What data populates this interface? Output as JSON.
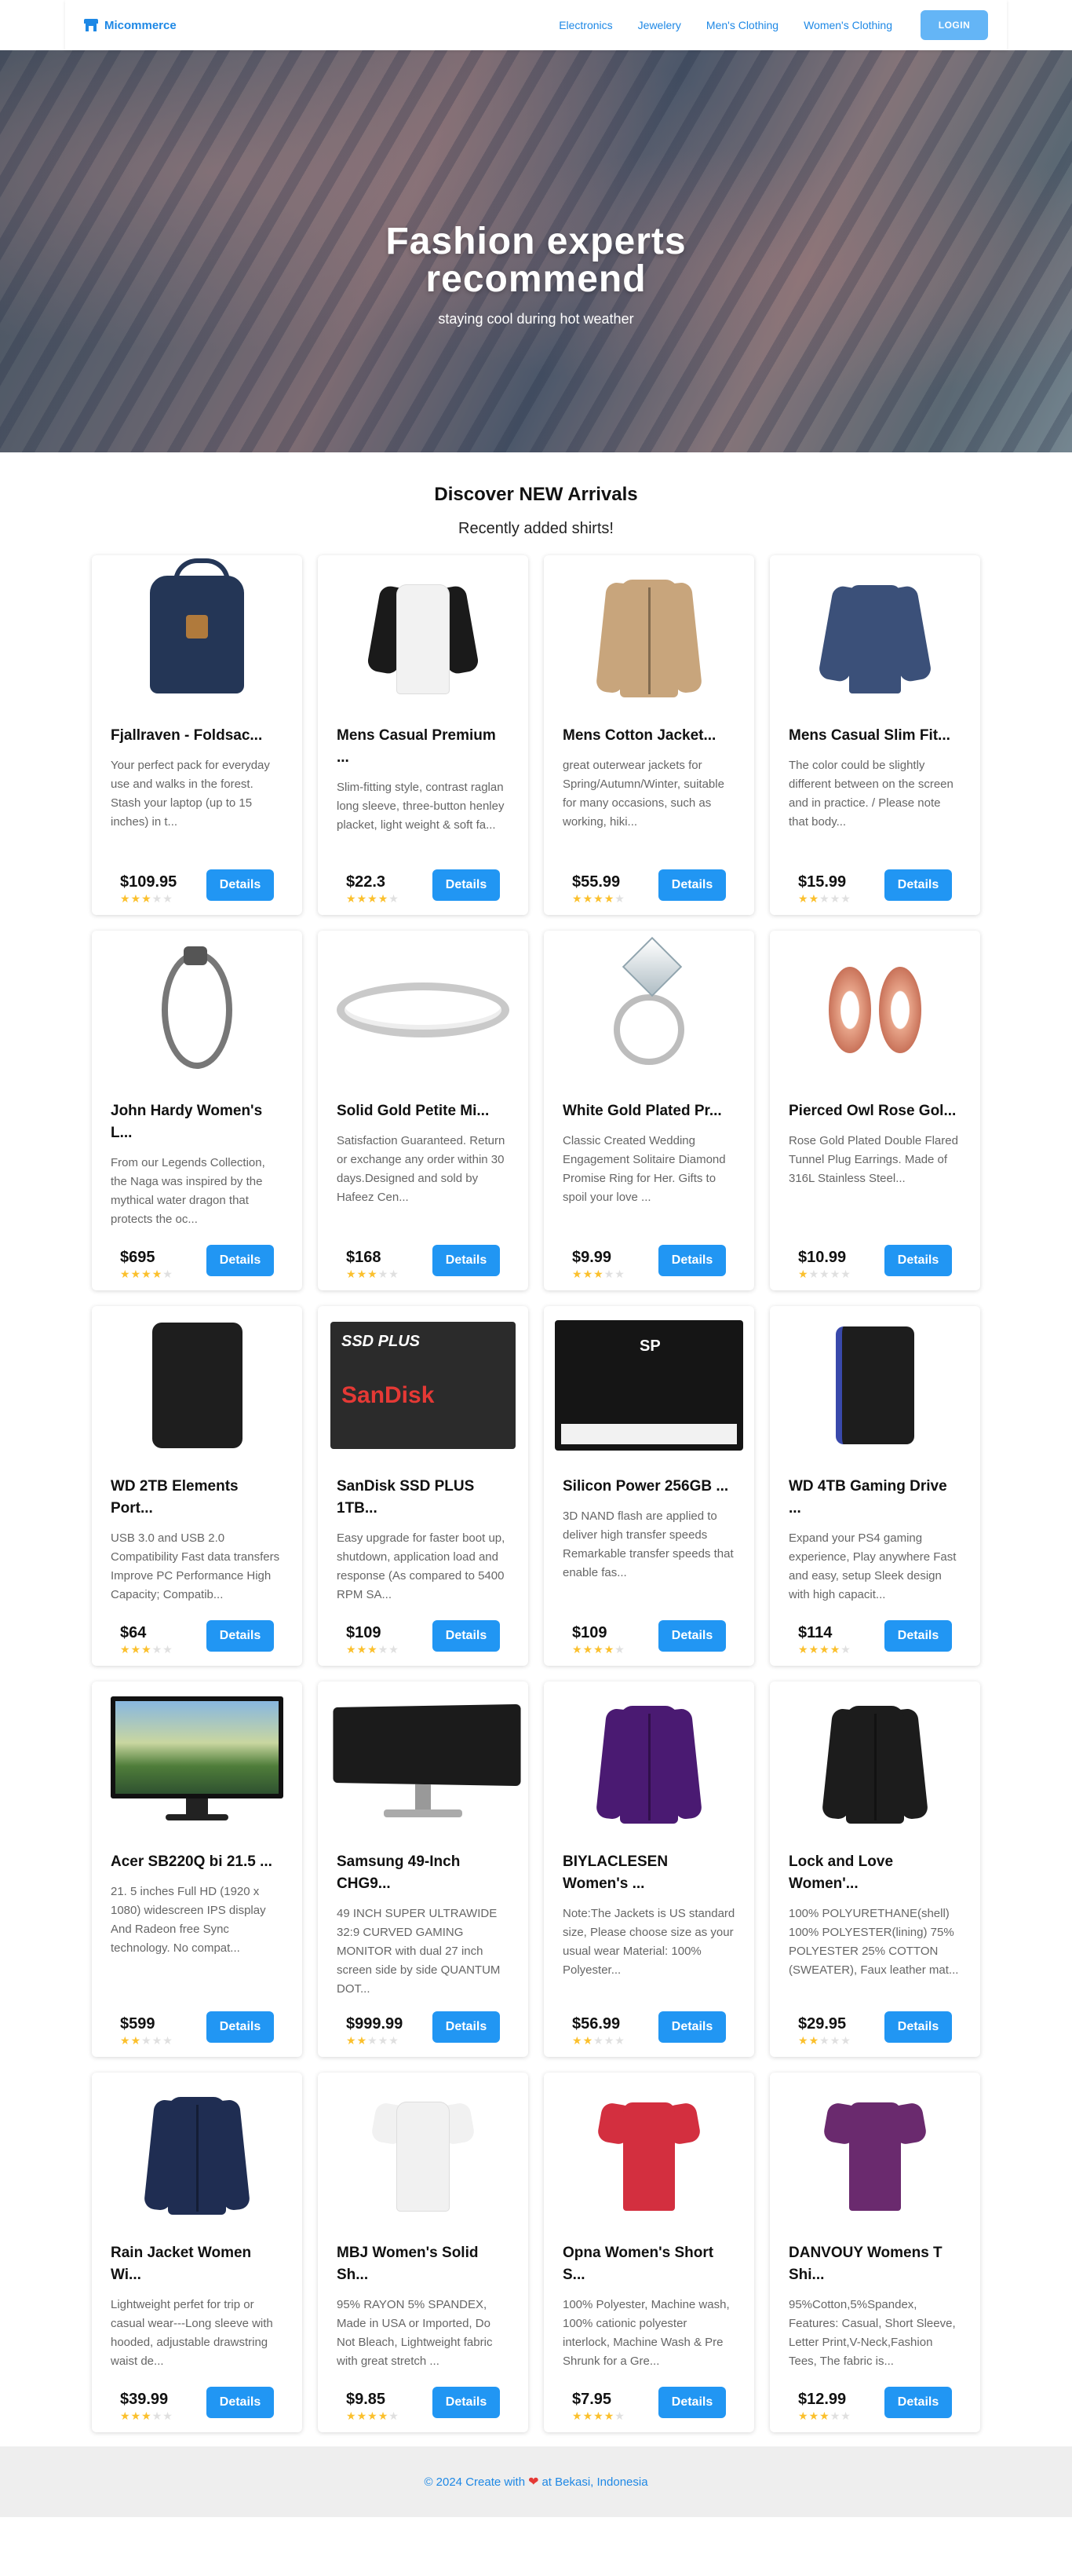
{
  "brand": {
    "name": "Micommerce"
  },
  "nav": {
    "links": [
      "Electronics",
      "Jewelery",
      "Men's Clothing",
      "Women's Clothing"
    ],
    "login_label": "LOGIN"
  },
  "hero": {
    "title_line1": "Fashion experts",
    "title_line2": "recommend",
    "subtitle": "staying cool during hot weather"
  },
  "section": {
    "title": "Discover NEW Arrivals",
    "subtitle": "Recently added shirts!"
  },
  "details_label": "Details",
  "products": [
    {
      "title": "Fjallraven - Foldsac...",
      "description": "Your perfect pack for everyday use and walks in the forest. Stash your laptop (up to 15 inches) in t...",
      "price": "$109.95",
      "rating": 3,
      "image": "backpack",
      "colors": {
        "a": "#243656"
      }
    },
    {
      "title": "Mens Casual Premium ...",
      "description": "Slim-fitting style, contrast raglan long sleeve, three-button henley placket, light weight & soft fa...",
      "price": "$22.3",
      "rating": 4,
      "image": "raglan-tee",
      "colors": {
        "a": "#f2f2f2",
        "b": "#1a1a1a"
      }
    },
    {
      "title": "Mens Cotton Jacket...",
      "description": "great outerwear jackets for Spring/Autumn/Winter, suitable for many occasions, such as working, hiki...",
      "price": "$55.99",
      "rating": 4,
      "image": "cotton-jacket",
      "colors": {
        "a": "#c8a57c"
      }
    },
    {
      "title": "Mens Casual Slim Fit...",
      "description": "The color could be slightly different between on the screen and in practice. / Please note that body...",
      "price": "$15.99",
      "rating": 2,
      "image": "slim-fit-shirt",
      "colors": {
        "a": "#3b5079"
      }
    },
    {
      "title": "John Hardy Women's L...",
      "description": "From our Legends Collection, the Naga was inspired by the mythical water dragon that protects the oc...",
      "price": "$695",
      "rating": 4,
      "image": "bracelet",
      "colors": {
        "a": "#777777"
      }
    },
    {
      "title": "Solid Gold Petite Mi...",
      "description": "Satisfaction Guaranteed. Return or exchange any order within 30 days.Designed and sold by Hafeez Cen...",
      "price": "$168",
      "rating": 3,
      "image": "band-ring",
      "colors": {
        "a": "#c9c9c9"
      }
    },
    {
      "title": "White Gold Plated Pr...",
      "description": "Classic Created Wedding Engagement Solitaire Diamond Promise Ring for Her. Gifts to spoil your love ...",
      "price": "$9.99",
      "rating": 3,
      "image": "diamond-ring",
      "colors": {
        "a": "#bdbdbd"
      }
    },
    {
      "title": "Pierced Owl Rose Gol...",
      "description": "Rose Gold Plated Double Flared Tunnel Plug Earrings. Made of 316L Stainless Steel...",
      "price": "$10.99",
      "rating": 1,
      "image": "tunnel-plugs",
      "colors": {
        "a": "#c9735a"
      }
    },
    {
      "title": "WD 2TB Elements Port...",
      "description": "USB 3.0 and USB 2.0 Compatibility Fast data transfers Improve PC Performance High Capacity; Compatib...",
      "price": "$64",
      "rating": 3,
      "image": "external-hdd",
      "colors": {
        "a": "#1e1e1e"
      }
    },
    {
      "title": "SanDisk SSD PLUS 1TB...",
      "description": "Easy upgrade for faster boot up, shutdown, application load and response (As compared to 5400 RPM SA...",
      "price": "$109",
      "rating": 3,
      "image": "sandisk-ssd",
      "ssd_label": "SSD PLUS",
      "ssd_brand": "SanDisk",
      "colors": {
        "a": "#2b2b2b"
      }
    },
    {
      "title": "Silicon Power 256GB ...",
      "description": "3D NAND flash are applied to deliver high transfer speeds Remarkable transfer speeds that enable fas...",
      "price": "$109",
      "rating": 4,
      "image": "sp-ssd",
      "colors": {
        "a": "#151515"
      }
    },
    {
      "title": "WD 4TB Gaming Drive ...",
      "description": "Expand your PS4 gaming experience, Play anywhere Fast and easy, setup Sleek design with high capacit...",
      "price": "$114",
      "rating": 4,
      "image": "gaming-drive",
      "colors": {
        "a": "#1d1d1d"
      }
    },
    {
      "title": "Acer SB220Q bi 21.5 ...",
      "description": "21. 5 inches Full HD (1920 x 1080) widescreen IPS display And Radeon free Sync technology. No compat...",
      "price": "$599",
      "rating": 2,
      "image": "monitor",
      "colors": {
        "a": "#111111"
      }
    },
    {
      "title": "Samsung 49-Inch CHG9...",
      "description": "49 INCH SUPER ULTRAWIDE 32:9 CURVED GAMING MONITOR with dual 27 inch screen side by side QUANTUM DOT...",
      "price": "$999.99",
      "rating": 2,
      "image": "ultrawide-monitor",
      "colors": {
        "a": "#1b1b1b"
      }
    },
    {
      "title": "BIYLACLESEN Women's ...",
      "description": "Note:The Jackets is US standard size, Please choose size as your usual wear Material: 100% Polyester...",
      "price": "$56.99",
      "rating": 2,
      "image": "purple-jacket",
      "colors": {
        "a": "#4a1a72"
      }
    },
    {
      "title": "Lock and Love Women'...",
      "description": "100% POLYURETHANE(shell) 100% POLYESTER(lining) 75% POLYESTER 25% COTTON (SWEATER), Faux leather mat...",
      "price": "$29.95",
      "rating": 2,
      "image": "leather-jacket",
      "colors": {
        "a": "#1c1c1c"
      }
    },
    {
      "title": "Rain Jacket Women Wi...",
      "description": "Lightweight perfet for trip or casual wear---Long sleeve with hooded, adjustable drawstring waist de...",
      "price": "$39.99",
      "rating": 3,
      "image": "rain-jacket",
      "colors": {
        "a": "#1f2d52"
      }
    },
    {
      "title": "MBJ Women's Solid Sh...",
      "description": "95% RAYON 5% SPANDEX, Made in USA or Imported, Do Not Bleach, Lightweight fabric with great stretch ...",
      "price": "$9.85",
      "rating": 4,
      "image": "white-tee",
      "colors": {
        "a": "#f1f1f1"
      }
    },
    {
      "title": "Opna Women's Short S...",
      "description": "100% Polyester, Machine wash, 100% cationic polyester interlock, Machine Wash & Pre Shrunk for a Gre...",
      "price": "$7.95",
      "rating": 4,
      "image": "red-tee",
      "colors": {
        "a": "#d32f3f"
      }
    },
    {
      "title": "DANVOUY Womens T Shi...",
      "description": "95%Cotton,5%Spandex, Features: Casual, Short Sleeve, Letter Print,V-Neck,Fashion Tees, The fabric is...",
      "price": "$12.99",
      "rating": 3,
      "image": "purple-tee",
      "colors": {
        "a": "#6a2a6e"
      }
    }
  ],
  "footer": {
    "before": "© 2024 Create with",
    "after": "at Bekasi, Indonesia"
  }
}
